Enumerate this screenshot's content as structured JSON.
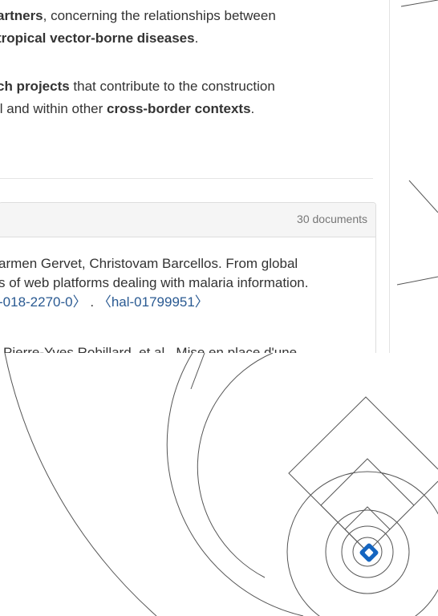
{
  "intro": {
    "p1": {
      "line1_bold": "artners",
      "line1_rest": ", concerning the relationships between",
      "line2_bold": "tropical vector-borne diseases",
      "line2_rest": "."
    },
    "p2": {
      "line1_bold": "ch projects",
      "line1_rest": " that contribute to the construction",
      "line2_start": "il and within other ",
      "line2_bold": "cross-border contexts",
      "line2_rest": "."
    }
  },
  "documents_panel": {
    "count_label": "30 documents",
    "entries": [
      {
        "line1": "armen Gervet, Christovam Barcellos. From global",
        "line2": "s of web platforms dealing with malaria information.",
        "doi_fragment": "-018-2270-0〉",
        "separator": ".",
        "hal_id": "〈hal-01799951〉"
      },
      {
        "line1": "Pierre-Yves Robillard, et al.. Mise en place d'une"
      }
    ]
  },
  "colors": {
    "link": "#2a5a92",
    "logo_blue": "#1565c0",
    "decor_line": "#555555"
  }
}
